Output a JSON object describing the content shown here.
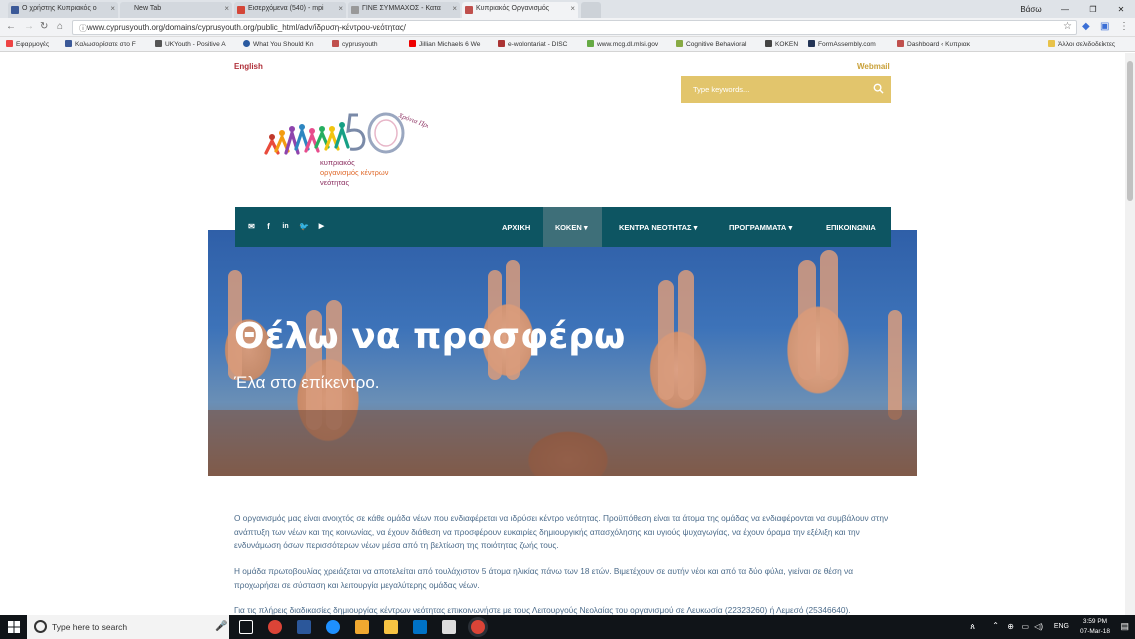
{
  "browser": {
    "tabs": [
      {
        "label": "Ο χρήστης Κυπριακός ο",
        "color": "#3b5998"
      },
      {
        "label": "New Tab",
        "color": "#dfe3e8"
      },
      {
        "label": "Εισερχόμενα (540) - mpi",
        "color": "#d44638"
      },
      {
        "label": "ΓΙΝΕ ΣΥΜΜΑΧΟΣ - Κατα",
        "color": "#888888"
      },
      {
        "label": "Κυπριακός Οργανισμός",
        "color": "#c0504d"
      }
    ],
    "profile": "Βάσω",
    "url": "www.cyprusyouth.org/domains/cyprusyouth.org/public_html/adv/ίδρυση-κέντρου-νεότητας/",
    "bookmarks": [
      "Εφαρμογές",
      "Καλωσορίσατε στο F",
      "UKYouth - Positive A",
      "What You Should Kn",
      "cyprusyouth",
      "Jillian Michaels 6 We",
      "e-wolontariat - DISC",
      "www.mcg.dl.mlsi.gov",
      "Cognitive Behavioral",
      "KOKEN",
      "FormAssembly.com",
      "Dashboard ‹ Κυπριακ"
    ],
    "other_bookmarks": "Άλλοι σελιδοδείκτες"
  },
  "site": {
    "lang_link": "English",
    "webmail": "Webmail",
    "search_placeholder": "Type keywords...",
    "logo": {
      "line1": "κυπριακός",
      "line2": "οργανισμός κέντρων",
      "line3": "νεότητας",
      "anniversary": "Χρόνια Προσφοράς",
      "number": "50"
    },
    "nav": [
      {
        "label": "ΑΡΧΙΚΗ",
        "dropdown": false
      },
      {
        "label": "ΚΟΚΕΝ",
        "dropdown": true,
        "active": true
      },
      {
        "label": "ΚΕΝΤΡΑ ΝΕΟΤΗΤΑΣ",
        "dropdown": true
      },
      {
        "label": "ΠΡΟΓΡΑΜΜΑΤΑ",
        "dropdown": true
      },
      {
        "label": "ΕΠΙΚΟΙΝΩΝΙΑ",
        "dropdown": false
      }
    ],
    "hero": {
      "title": "Θέλω να προσφέρω",
      "subtitle": "Έλα στο επίκεντρο."
    },
    "paragraphs": [
      "Ο οργανισμός μας είναι ανοιχτός σε κάθε ομάδα νέων που ενδιαφέρεται να ιδρύσει κέντρο νεότητας. Προϋπόθεση είναι τα άτομα της ομάδας να ενδιαφέρονται να συμβάλουν στην ανάπτυξη των νέων και της κοινωνίας, να έχουν διάθεση να προσφέρουν ευκαιρίες δημιουργικής απασχόλησης και υγιούς ψυχαγωγίας, να έχουν όραμα την εξέλιξη και την ενδυνάμωση όσων περισσότερων νέων μέσα από τη βελτίωση της ποιότητας ζωής τους.",
      "Η ομάδα πρωτοβουλίας χρειάζεται να αποτελείται από τουλάχιστον 5 άτομα ηλικίας πάνω των 18 ετών. Βιμετέχουν σε αυτήν νέοι και από τα δύο φύλα, γιείναι σε θέση να προχωρήσει σε σύσταση και λειτουργία μεγαλύτερης ομάδας νέων.",
      "Για τις πλήρεις διαδικασίες δημιουργίας κέντρων νεότητας επικοινωνήστε με τους Λειτουργούς Νεολαίας του οργανισμού σε Λευκωσία (22323260) ή Λεμεσό (25346640)."
    ],
    "colors": {
      "nav": "#0d5562",
      "search": "#e2c56c",
      "accent": "#b0303a"
    }
  },
  "taskbar": {
    "search_placeholder": "Type here to search",
    "lang": "ENG",
    "time": "3:59 PM",
    "date": "07-Mar-18"
  }
}
